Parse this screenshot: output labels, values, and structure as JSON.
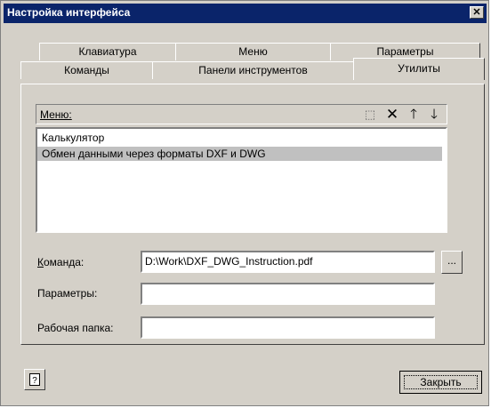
{
  "window": {
    "title": "Настройка интерфейса",
    "close_glyph": "✕"
  },
  "tabs": {
    "back_row": [
      {
        "label": "Клавиатура"
      },
      {
        "label": "Меню"
      },
      {
        "label": "Параметры"
      }
    ],
    "front_row": [
      {
        "label": "Команды"
      },
      {
        "label": "Панели инструментов"
      },
      {
        "label": "Утилиты",
        "active": true
      }
    ]
  },
  "menu_section": {
    "label": "Меню:",
    "toolbar": [
      {
        "icon": "new-item-icon",
        "glyph": "⬚"
      },
      {
        "icon": "delete-icon",
        "glyph": "✕"
      },
      {
        "icon": "arrow-up-icon",
        "glyph": "🡑"
      },
      {
        "icon": "arrow-down-icon",
        "glyph": "🡓"
      }
    ],
    "items": [
      {
        "label": "Калькулятор",
        "selected": false
      },
      {
        "label": "Обмен данными через форматы DXF и DWG",
        "selected": true
      }
    ]
  },
  "form": {
    "command_label": "Команда:",
    "command_value": "D:\\Work\\DXF_DWG_Instruction.pdf",
    "browse_label": "...",
    "parameters_label": "Параметры:",
    "parameters_value": "",
    "workdir_label": "Рабочая папка:",
    "workdir_value": ""
  },
  "footer": {
    "help_glyph": "?",
    "close_label": "Закрыть"
  }
}
